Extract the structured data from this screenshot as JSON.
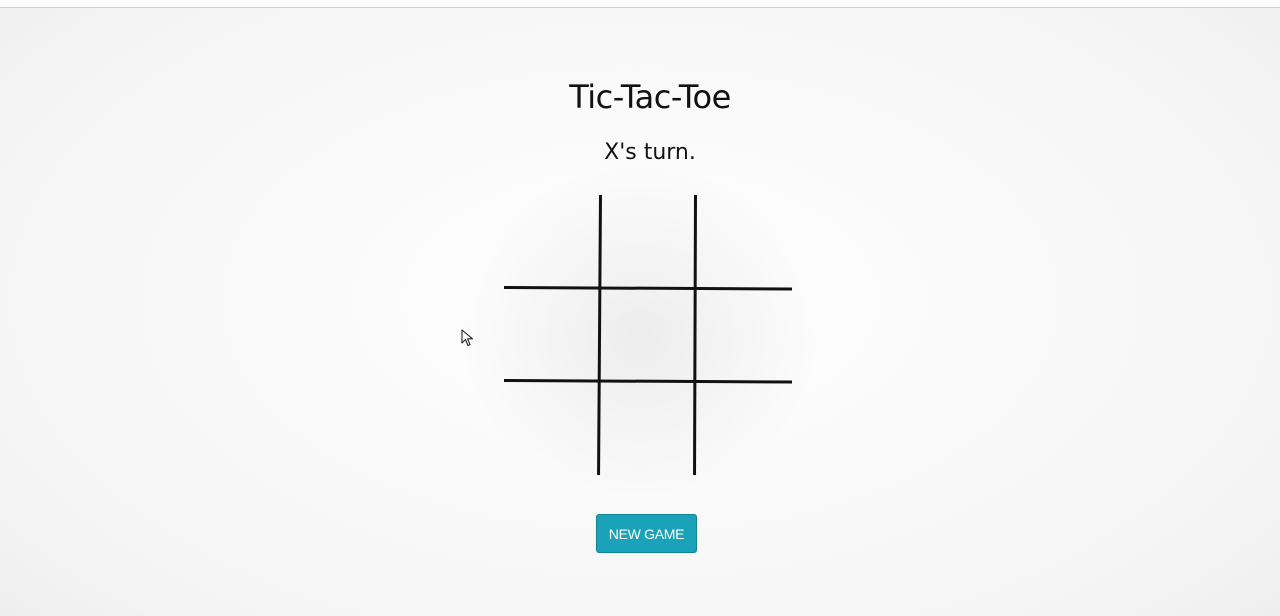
{
  "game": {
    "title": "Tic-Tac-Toe",
    "status": "X's turn.",
    "cells": [
      "",
      "",
      "",
      "",
      "",
      "",
      "",
      "",
      ""
    ]
  },
  "controls": {
    "new_game_label": "NEW GAME"
  },
  "colors": {
    "button": "#1aa3b8",
    "button_text": "#ffffff",
    "grid_lines": "#111111",
    "text": "#111111"
  },
  "icons": {
    "cursor": "mouse-pointer-icon"
  }
}
